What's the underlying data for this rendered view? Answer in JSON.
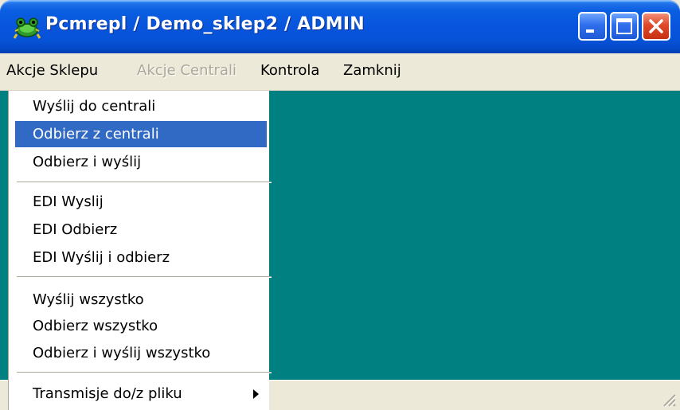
{
  "window": {
    "title": "Pcmrepl / Demo_sklep2 / ADMIN",
    "icon": "frog-app-icon",
    "controls": [
      "minimize-icon",
      "maximize-icon",
      "close-icon"
    ]
  },
  "menubar": {
    "items": [
      {
        "label": "Akcje Sklepu",
        "enabled": true,
        "open": true
      },
      {
        "label": "Akcje Centrali",
        "enabled": false
      },
      {
        "label": "Kontrola",
        "enabled": true
      },
      {
        "label": "Zamknij",
        "enabled": true
      }
    ]
  },
  "dropdown": {
    "groups": [
      {
        "items": [
          {
            "label": "Wyślij do centrali"
          },
          {
            "label": "Odbierz z centrali",
            "highlighted": true
          },
          {
            "label": "Odbierz i wyślij"
          }
        ]
      },
      {
        "items": [
          {
            "label": "EDI Wyslij"
          },
          {
            "label": "EDI Odbierz"
          },
          {
            "label": "EDI Wyślij i odbierz"
          }
        ]
      },
      {
        "items": [
          {
            "label": "Wyślij wszystko"
          },
          {
            "label": "Odbierz wszystko"
          },
          {
            "label": "Odbierz i wyślij wszystko"
          }
        ]
      },
      {
        "items": [
          {
            "label": "Transmisje do/z pliku",
            "submenu": true
          }
        ]
      }
    ]
  },
  "colors": {
    "client_background": "#008080",
    "menu_highlight": "#316ac5",
    "titlebar_blue": "#0855dd",
    "close_red": "#e0482a",
    "disabled_text": "#aca899"
  }
}
